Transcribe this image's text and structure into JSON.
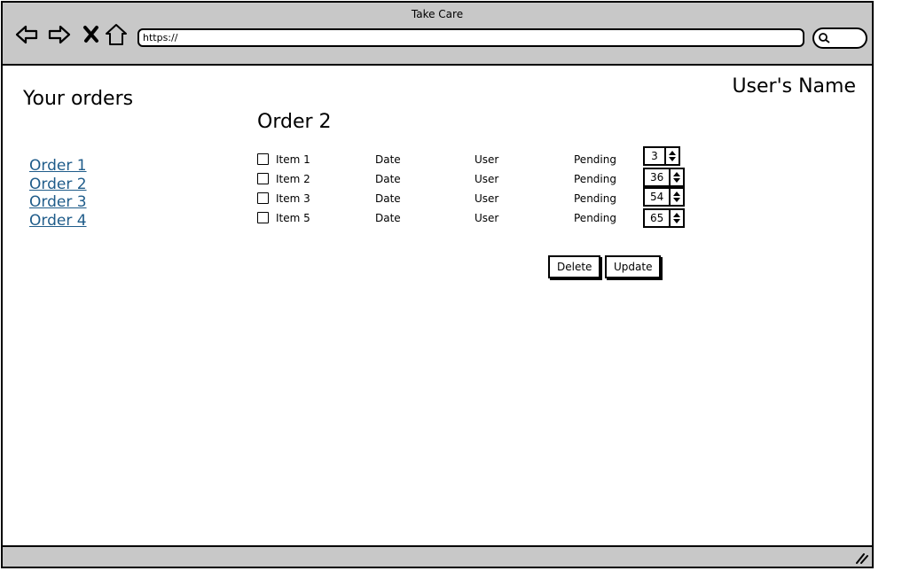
{
  "window": {
    "title": "Take Care"
  },
  "browser": {
    "url": "https://",
    "icons": [
      "back-icon",
      "forward-icon",
      "close-icon",
      "home-icon",
      "search-icon"
    ]
  },
  "header": {
    "heading": "Your orders",
    "user_name": "User's Name"
  },
  "sidebar": {
    "orders": [
      {
        "label": "Order 1"
      },
      {
        "label": "Order 2"
      },
      {
        "label": "Order 3"
      },
      {
        "label": "Order 4"
      }
    ]
  },
  "main": {
    "order_title": "Order 2",
    "rows": [
      {
        "item": "Item 1",
        "date": "Date",
        "user": "User",
        "status": "Pending",
        "quantity": "3"
      },
      {
        "item": "Item 2",
        "date": "Date",
        "user": "User",
        "status": "Pending",
        "quantity": "36"
      },
      {
        "item": "Item 3",
        "date": "Date",
        "user": "User",
        "status": "Pending",
        "quantity": "54"
      },
      {
        "item": "Item 5",
        "date": "Date",
        "user": "User",
        "status": "Pending",
        "quantity": "65"
      }
    ],
    "delete_label": "Delete",
    "update_label": "Update"
  },
  "colors": {
    "chrome": "#c8c8c8",
    "link": "#1f5c8a"
  }
}
